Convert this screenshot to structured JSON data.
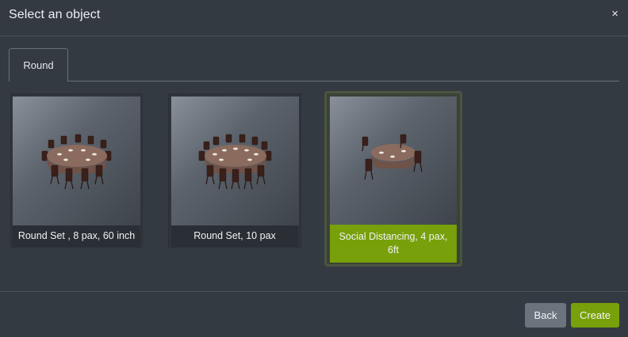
{
  "dialog": {
    "title": "Select an object",
    "close_glyph": "×"
  },
  "tabs": [
    {
      "label": "Round",
      "active": true
    }
  ],
  "objects": [
    {
      "label": "Round Set , 8 pax, 60 inch",
      "selected": false
    },
    {
      "label": "Round Set, 10 pax",
      "selected": false
    },
    {
      "label": "Social Distancing, 4 pax, 6ft",
      "selected": true
    }
  ],
  "buttons": {
    "back": "Back",
    "create": "Create"
  },
  "colors": {
    "background": "#343a42",
    "accent": "#78a00a",
    "secondary_button": "#6b737c"
  }
}
